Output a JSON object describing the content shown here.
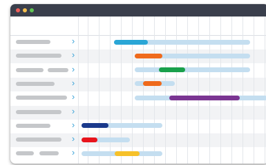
{
  "window": {
    "buttons": [
      {
        "name": "close",
        "color": "#ee5f5b"
      },
      {
        "name": "minimize",
        "color": "#f5bf4f"
      },
      {
        "name": "maximize",
        "color": "#61c554"
      }
    ]
  },
  "colors": {
    "track": "#c4def0",
    "label_placeholder": "#c5c7ca",
    "chevron": "#3aa3d8"
  },
  "tasks": [
    {
      "placeholders": 1,
      "expand_icon": "chevron-right-icon",
      "progress_color": "#2aa6d6",
      "progress": 0.25
    },
    {
      "placeholders": 1,
      "expand_icon": "chevron-right-icon",
      "progress_color": "#ef6a1c",
      "progress": 0.24
    },
    {
      "placeholders": 2,
      "expand_icon": "chevron-right-icon",
      "progress_color": "#19a04b",
      "progress": 0.23
    },
    {
      "placeholders": 1,
      "expand_icon": "chevron-right-icon",
      "progress_color": "#ef6a1c",
      "progress": 0.46
    },
    {
      "placeholders": 1,
      "expand_icon": "chevron-right-icon",
      "progress_color": "#7a3592",
      "progress": 0.53
    },
    {
      "placeholders": 1,
      "expand_icon": "chevron-right-icon",
      "progress_color": null,
      "progress": 0
    },
    {
      "placeholders": 1,
      "expand_icon": "chevron-right-icon",
      "progress_color": "#1b3a8c",
      "progress": 0.33
    },
    {
      "placeholders": 1,
      "expand_icon": "chevron-right-icon",
      "progress_color": "#e8141c",
      "progress": 0.33
    },
    {
      "placeholders": 2,
      "expand_icon": "chevron-right-icon",
      "progress_color": "#f6c12a",
      "progress": 0.31
    }
  ]
}
